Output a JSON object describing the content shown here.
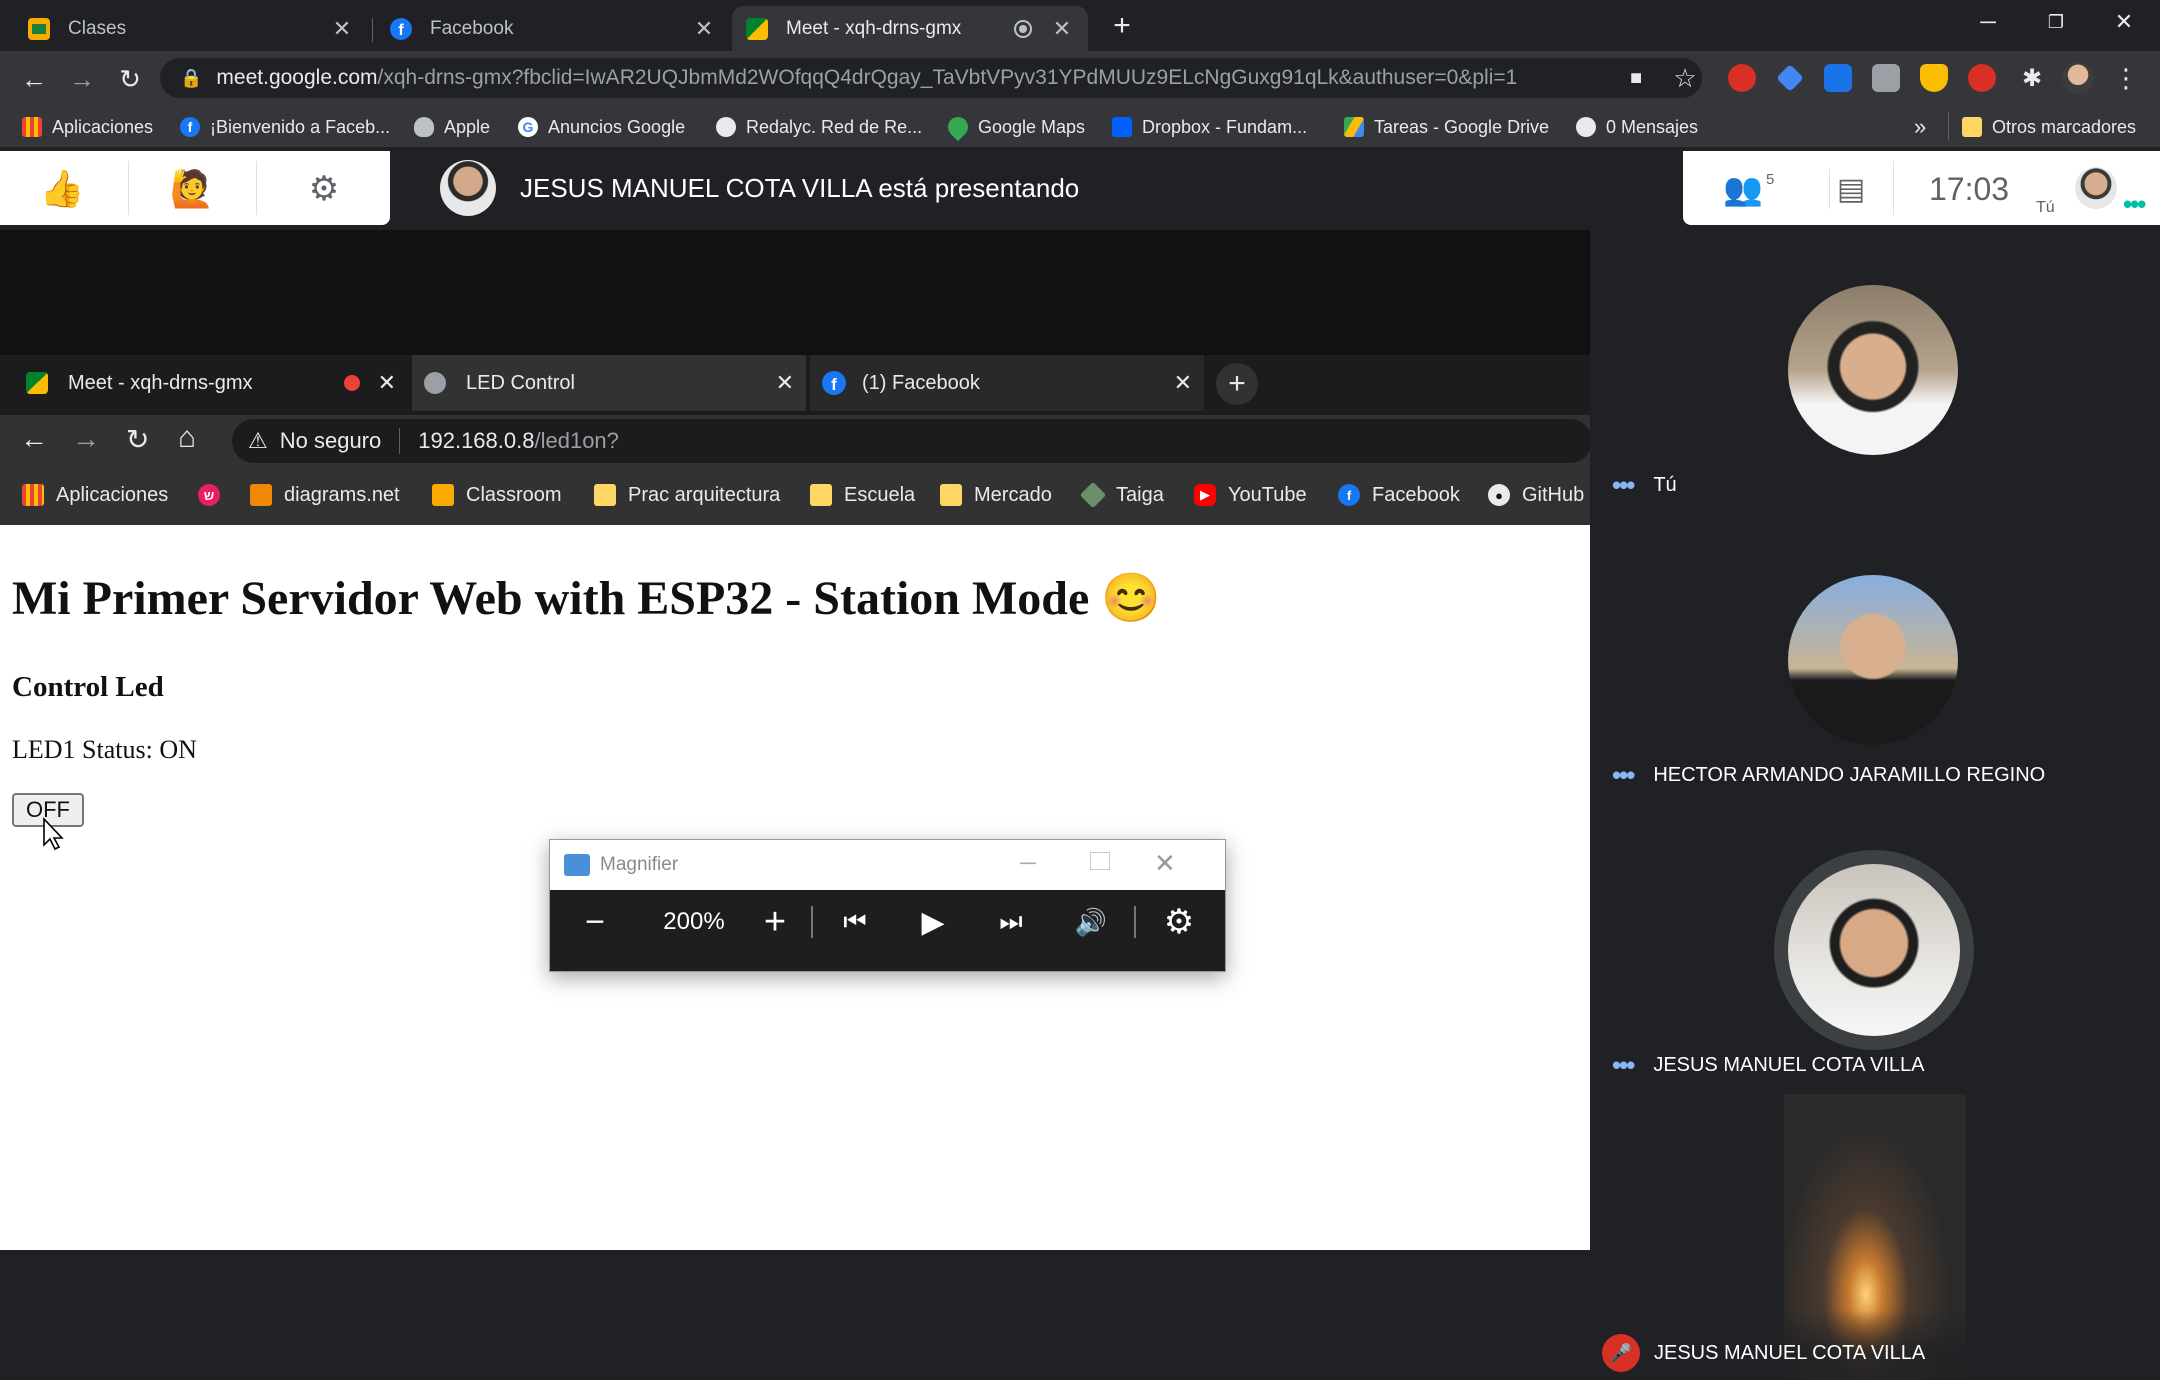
{
  "browser": {
    "tabs": [
      {
        "title": "Clases",
        "favicon": "classroom-icon"
      },
      {
        "title": "Facebook",
        "favicon": "facebook-icon"
      },
      {
        "title": "Meet - xqh-drns-gmx",
        "favicon": "meet-icon",
        "active": true
      }
    ],
    "url_host": "meet.google.com",
    "url_path": "/xqh-drns-gmx?fbclid=IwAR2UQJbmMd2WOfqqQ4drQgay_TaVbtVPyv31YPdMUUz9ELcNgGuxg91qLk&authuser=0&pli=1",
    "bookmarks": [
      {
        "label": "Aplicaciones",
        "icon": "apps-grid-icon"
      },
      {
        "label": "¡Bienvenido a Faceb...",
        "icon": "facebook-icon"
      },
      {
        "label": "Apple",
        "icon": "apple-icon"
      },
      {
        "label": "Anuncios Google",
        "icon": "google-icon"
      },
      {
        "label": "Redalyc. Red de Re...",
        "icon": "globe-icon"
      },
      {
        "label": "Google Maps",
        "icon": "maps-pin-icon"
      },
      {
        "label": "Dropbox - Fundam...",
        "icon": "dropbox-icon"
      },
      {
        "label": "Tareas - Google Drive",
        "icon": "drive-icon"
      },
      {
        "label": "0 Mensajes",
        "icon": "globe-icon"
      }
    ],
    "bookmarks_overflow": "»",
    "other_bookmarks": "Otros marcadores"
  },
  "meet": {
    "presenting_text": "JESUS MANUEL COTA VILLA está presentando",
    "participant_count": "5",
    "time": "17:03",
    "self_label": "Tú",
    "participants": [
      {
        "name": "Tú",
        "muted": false
      },
      {
        "name": "HECTOR ARMANDO JARAMILLO REGINO",
        "muted": false
      },
      {
        "name": "JESUS MANUEL COTA VILLA",
        "muted": false
      },
      {
        "name": "JESUS MANUEL COTA VILLA",
        "muted": true
      }
    ]
  },
  "shared_screen": {
    "tabs": [
      {
        "title": "Meet - xqh-drns-gmx"
      },
      {
        "title": "LED Control",
        "active": true
      },
      {
        "title": "(1) Facebook"
      }
    ],
    "security_label": "No seguro",
    "url_host": "192.168.0.8",
    "url_path": "/led1on?",
    "bookmarks": [
      {
        "label": "Aplicaciones"
      },
      {
        "label": ""
      },
      {
        "label": "diagrams.net"
      },
      {
        "label": "Classroom"
      },
      {
        "label": "Prac arquitectura"
      },
      {
        "label": "Escuela"
      },
      {
        "label": "Mercado"
      },
      {
        "label": "Taiga"
      },
      {
        "label": "YouTube"
      },
      {
        "label": "Facebook"
      },
      {
        "label": "GitHub"
      }
    ],
    "page": {
      "heading": "Mi Primer Servidor Web with ESP32 - Station Mode 😊",
      "subheading": "Control Led",
      "status": "LED1 Status: ON",
      "button_label": "OFF"
    },
    "magnifier": {
      "title": "Magnifier",
      "zoom": "200%"
    }
  },
  "colors": {
    "accent_blue": "#8ab4f8",
    "muted_red": "#d93025"
  }
}
